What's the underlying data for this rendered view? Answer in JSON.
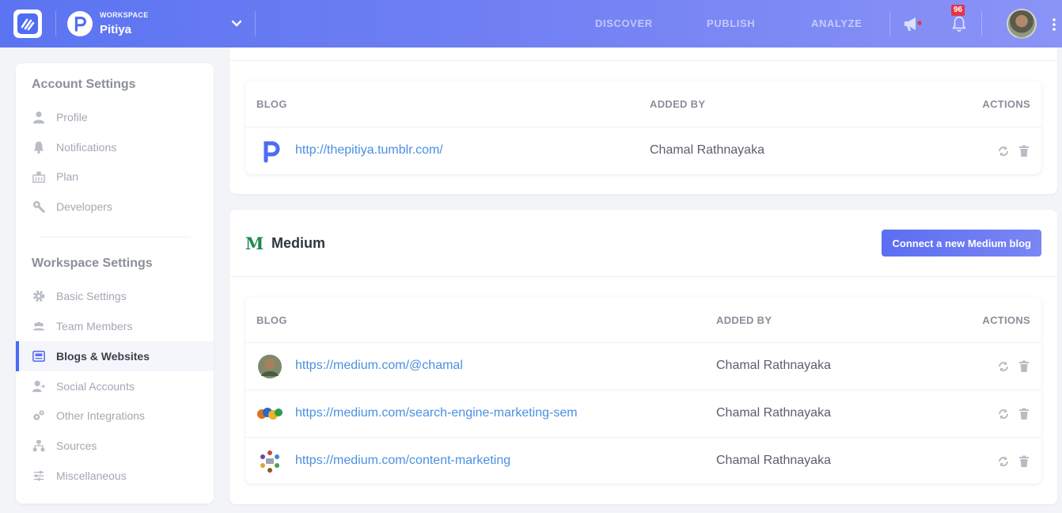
{
  "topbar": {
    "workspace_label": "WORKSPACE",
    "workspace_name": "Pitiya",
    "nav": [
      "DISCOVER",
      "PUBLISH",
      "ANALYZE"
    ],
    "notification_count": "96",
    "icons": [
      "app-logo-icon",
      "chevron-down-icon",
      "megaphone-icon",
      "bell-icon",
      "more-vertical-icon"
    ]
  },
  "sidebar": {
    "account_title": "Account Settings",
    "account_items": [
      {
        "label": "Profile",
        "icon": "user-icon"
      },
      {
        "label": "Notifications",
        "icon": "bell-icon"
      },
      {
        "label": "Plan",
        "icon": "plan-icon"
      },
      {
        "label": "Developers",
        "icon": "wrench-icon"
      }
    ],
    "workspace_title": "Workspace Settings",
    "workspace_items": [
      {
        "label": "Basic Settings",
        "icon": "gear-icon"
      },
      {
        "label": "Team Members",
        "icon": "users-icon"
      },
      {
        "label": "Blogs & Websites",
        "icon": "blog-icon",
        "active": true
      },
      {
        "label": "Social Accounts",
        "icon": "user-share-icon"
      },
      {
        "label": "Other Integrations",
        "icon": "cogs-icon"
      },
      {
        "label": "Sources",
        "icon": "sitemap-icon"
      },
      {
        "label": "Miscellaneous",
        "icon": "sliders-icon"
      }
    ]
  },
  "tumblr_table": {
    "headers": {
      "blog": "BLOG",
      "added_by": "ADDED BY",
      "actions": "ACTIONS"
    },
    "rows": [
      {
        "url": "http://thepitiya.tumblr.com/",
        "added_by": "Chamal Rathnayaka"
      }
    ]
  },
  "medium": {
    "title": "Medium",
    "logo": "M",
    "connect_button": "Connect a new Medium blog",
    "table": {
      "headers": {
        "blog": "BLOG",
        "added_by": "ADDED BY",
        "actions": "ACTIONS"
      },
      "rows": [
        {
          "url": "https://medium.com/@chamal",
          "added_by": "Chamal Rathnayaka"
        },
        {
          "url": "https://medium.com/search-engine-marketing-sem",
          "added_by": "Chamal Rathnayaka"
        },
        {
          "url": "https://medium.com/content-marketing",
          "added_by": "Chamal Rathnayaka"
        }
      ]
    }
  },
  "colors": {
    "accent": "#5b6ef2",
    "link": "#4a90e2",
    "badge": "#e2344a",
    "medium_green": "#1a8a4a"
  }
}
